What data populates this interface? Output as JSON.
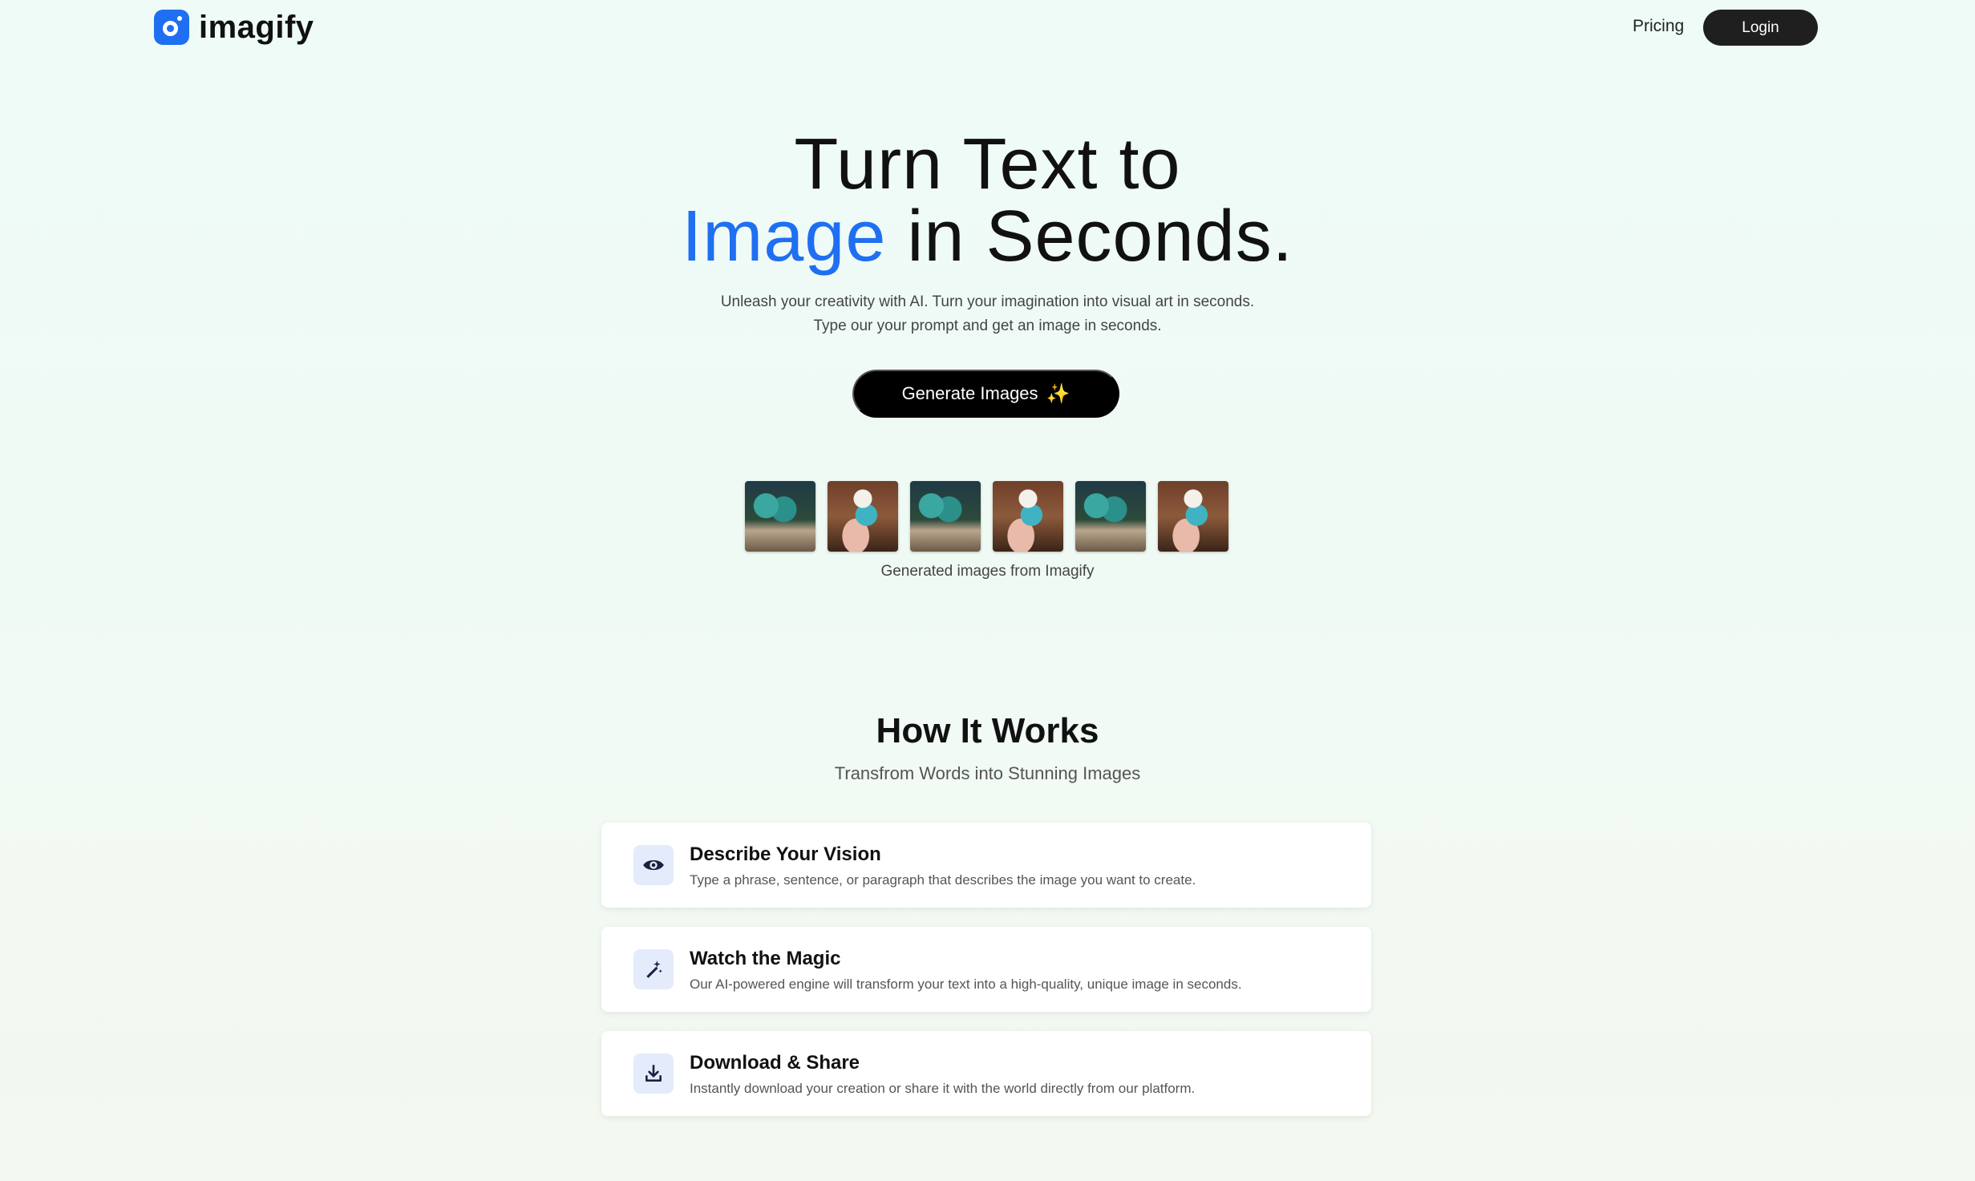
{
  "header": {
    "brand": "imagify",
    "pricing_label": "Pricing",
    "login_label": "Login"
  },
  "hero": {
    "title_line1": "Turn Text to",
    "title_accent": "Image",
    "title_line2_rest": " in Seconds.",
    "subtitle_line1": "Unleash your creativity with AI. Turn your imagination into visual art in seconds.",
    "subtitle_line2": "Type our your prompt and get an image in seconds.",
    "cta_label": "Generate Images",
    "cta_icon": "sparkles-icon"
  },
  "gallery": {
    "caption": "Generated images from Imagify",
    "images": [
      "monster-scene",
      "chef-monster-cake",
      "monster-scene",
      "chef-monster-cake",
      "monster-scene",
      "chef-monster-cake"
    ]
  },
  "how_it_works": {
    "title": "How It Works",
    "subtitle": "Transfrom Words into Stunning Images",
    "steps": [
      {
        "icon": "eye-icon",
        "title": "Describe Your Vision",
        "description": "Type a phrase, sentence, or paragraph that describes the image you want to create."
      },
      {
        "icon": "magic-wand-icon",
        "title": "Watch the Magic",
        "description": "Our AI-powered engine will transform your text into a high-quality, unique image in seconds."
      },
      {
        "icon": "download-icon",
        "title": "Download & Share",
        "description": "Instantly download your creation or share it with the world directly from our platform."
      }
    ]
  },
  "colors": {
    "accent": "#1f6ff2",
    "dark_button": "#1f1f1f",
    "cta_button": "#000000",
    "icon_bg": "#e4ebfb"
  }
}
